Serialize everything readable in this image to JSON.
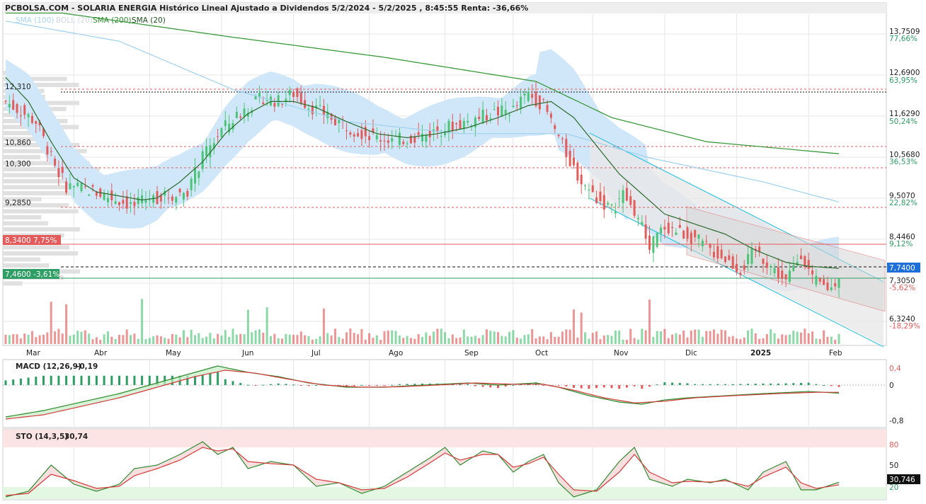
{
  "header": {
    "title": "PCBOLSA.COM - SOLARIA ENERGIA Histórico Lineal Ajustado a Dividendos 5/2/2024 - 5/2/2025 , 8:45:55 Renta: -36,66%"
  },
  "legend": {
    "items": [
      {
        "label": "SMA (100)",
        "color": "#a8d4f0"
      },
      {
        "label": "BOLL (20)",
        "color": "#cfe3f3"
      },
      {
        "label": "SMA (200)",
        "color": "#2e8b2e"
      },
      {
        "label": "SMA (20)",
        "color": "#1f4f1f"
      }
    ]
  },
  "colors": {
    "up": "#4cc477",
    "down": "#e35b5b",
    "boll_fill": "#cfe7f8",
    "sma200": "#3c9a3c",
    "sma100": "#9fd0ee",
    "sma20": "#2d6b2d",
    "channel": "#36c5e0",
    "grid": "#e6e6e6"
  },
  "price_axis": {
    "ticks": [
      {
        "price": "13,7509",
        "pct": "77,66%"
      },
      {
        "price": "12,6900",
        "pct": "63,95%"
      },
      {
        "price": "11,6290",
        "pct": "50,24%"
      },
      {
        "price": "10,5680",
        "pct": "36,53%"
      },
      {
        "price": "9,5070",
        "pct": "22,82%"
      },
      {
        "price": "8,4460",
        "pct": "9,12%"
      },
      {
        "price": "7,3050",
        "pct": "-5,62%"
      },
      {
        "price": "6,3240",
        "pct": "-18,29%"
      }
    ],
    "current_price": "7,7400"
  },
  "level_labels": [
    {
      "label": "12,310"
    },
    {
      "label": "10,860"
    },
    {
      "label": "10,300"
    },
    {
      "label": "9,2850"
    }
  ],
  "price_markers": [
    {
      "label": "8,3400  7,75%",
      "color": "#e35b5b"
    },
    {
      "label": "7,4600  -3,61%",
      "color": "#2e9e64"
    }
  ],
  "x_axis": {
    "labels": [
      "Mar",
      "Abr",
      "May",
      "Jun",
      "Jul",
      "Ago",
      "Sep",
      "Oct",
      "Nov",
      "Dic",
      "2025",
      "Feb"
    ]
  },
  "macd": {
    "title": "MACD (12,26,9)",
    "value": "-0,19",
    "ticks": [
      "0,4",
      "0",
      "-0,8"
    ]
  },
  "sto": {
    "title": "STO (14,3,5)",
    "value": "30,74",
    "ticks": [
      "80",
      "50",
      "20"
    ],
    "current": "30,746"
  },
  "chart_data": {
    "type": "candlestick",
    "title": "SOLARIA ENERGIA Histórico Lineal Ajustado a Dividendos 5/2/2024 - 5/2/2025",
    "price_ylim": [
      5.7,
      14.4
    ],
    "x_months": [
      "Mar",
      "Abr",
      "May",
      "Jun",
      "Jul",
      "Ago",
      "Sep",
      "Oct",
      "Nov",
      "Dic",
      "2025",
      "Feb"
    ],
    "close_anchors": [
      [
        0,
        12.0
      ],
      [
        8,
        11.5
      ],
      [
        12,
        10.6
      ],
      [
        16,
        9.9
      ],
      [
        22,
        9.8
      ],
      [
        28,
        9.6
      ],
      [
        34,
        9.4
      ],
      [
        38,
        9.6
      ],
      [
        44,
        9.65
      ],
      [
        48,
        9.8
      ],
      [
        52,
        10.6
      ],
      [
        57,
        11.3
      ],
      [
        63,
        11.8
      ],
      [
        68,
        12.1
      ],
      [
        72,
        12.0
      ],
      [
        76,
        12.2
      ],
      [
        80,
        11.9
      ],
      [
        86,
        11.6
      ],
      [
        92,
        11.3
      ],
      [
        98,
        11.1
      ],
      [
        104,
        11.05
      ],
      [
        110,
        11.15
      ],
      [
        116,
        11.35
      ],
      [
        122,
        11.5
      ],
      [
        128,
        11.7
      ],
      [
        134,
        11.8
      ],
      [
        138,
        12.2
      ],
      [
        142,
        11.9
      ],
      [
        145,
        11.3
      ],
      [
        148,
        10.7
      ],
      [
        152,
        10.0
      ],
      [
        156,
        9.6
      ],
      [
        160,
        9.3
      ],
      [
        163,
        9.7
      ],
      [
        167,
        9.1
      ],
      [
        170,
        8.4
      ],
      [
        174,
        8.9
      ],
      [
        178,
        8.75
      ],
      [
        182,
        8.6
      ],
      [
        186,
        8.3
      ],
      [
        190,
        8.1
      ],
      [
        194,
        7.8
      ],
      [
        198,
        8.3
      ],
      [
        202,
        7.9
      ],
      [
        206,
        7.5
      ],
      [
        210,
        8.25
      ],
      [
        213,
        7.55
      ],
      [
        216,
        7.4
      ],
      [
        218,
        7.35
      ],
      [
        220,
        7.7
      ]
    ],
    "sma20_anchors": [
      [
        0,
        12.6
      ],
      [
        6,
        12.0
      ],
      [
        12,
        11.0
      ],
      [
        18,
        10.1
      ],
      [
        24,
        9.75
      ],
      [
        30,
        9.65
      ],
      [
        36,
        9.55
      ],
      [
        40,
        9.6
      ],
      [
        46,
        10.0
      ],
      [
        52,
        10.5
      ],
      [
        58,
        11.2
      ],
      [
        64,
        11.7
      ],
      [
        70,
        12.0
      ],
      [
        76,
        12.0
      ],
      [
        82,
        11.85
      ],
      [
        90,
        11.5
      ],
      [
        98,
        11.2
      ],
      [
        106,
        11.1
      ],
      [
        114,
        11.2
      ],
      [
        122,
        11.35
      ],
      [
        130,
        11.6
      ],
      [
        138,
        11.9
      ],
      [
        144,
        12.0
      ],
      [
        150,
        11.6
      ],
      [
        156,
        10.9
      ],
      [
        162,
        10.2
      ],
      [
        168,
        9.7
      ],
      [
        174,
        9.2
      ],
      [
        182,
        8.95
      ],
      [
        190,
        8.7
      ],
      [
        198,
        8.3
      ],
      [
        206,
        8.0
      ],
      [
        212,
        7.9
      ],
      [
        220,
        7.85
      ]
    ],
    "sma100_anchors": [
      [
        0,
        14.0
      ],
      [
        30,
        13.5
      ],
      [
        60,
        12.3
      ],
      [
        90,
        11.5
      ],
      [
        120,
        11.2
      ],
      [
        148,
        11.2
      ],
      [
        170,
        10.6
      ],
      [
        200,
        10.0
      ],
      [
        220,
        9.5
      ]
    ],
    "sma200_anchors": [
      [
        15,
        14.2
      ],
      [
        60,
        13.6
      ],
      [
        100,
        13.1
      ],
      [
        140,
        12.5
      ],
      [
        160,
        11.6
      ],
      [
        185,
        11.0
      ],
      [
        220,
        10.7
      ]
    ],
    "macd_line": [
      [
        0,
        -0.75
      ],
      [
        10,
        -0.6
      ],
      [
        20,
        -0.4
      ],
      [
        30,
        -0.2
      ],
      [
        40,
        0.05
      ],
      [
        50,
        0.3
      ],
      [
        56,
        0.45
      ],
      [
        64,
        0.3
      ],
      [
        72,
        0.2
      ],
      [
        80,
        0.05
      ],
      [
        90,
        -0.05
      ],
      [
        100,
        -0.05
      ],
      [
        110,
        0.0
      ],
      [
        122,
        0.05
      ],
      [
        130,
        0.0
      ],
      [
        140,
        0.05
      ],
      [
        146,
        -0.05
      ],
      [
        154,
        -0.25
      ],
      [
        162,
        -0.4
      ],
      [
        168,
        -0.45
      ],
      [
        174,
        -0.35
      ],
      [
        180,
        -0.3
      ],
      [
        190,
        -0.25
      ],
      [
        200,
        -0.2
      ],
      [
        212,
        -0.15
      ],
      [
        220,
        -0.19
      ]
    ],
    "signal_line": [
      [
        0,
        -0.8
      ],
      [
        10,
        -0.7
      ],
      [
        20,
        -0.5
      ],
      [
        30,
        -0.3
      ],
      [
        40,
        -0.05
      ],
      [
        50,
        0.2
      ],
      [
        58,
        0.35
      ],
      [
        66,
        0.28
      ],
      [
        74,
        0.15
      ],
      [
        84,
        0.0
      ],
      [
        94,
        -0.05
      ],
      [
        104,
        -0.04
      ],
      [
        114,
        0.0
      ],
      [
        124,
        0.05
      ],
      [
        134,
        0.02
      ],
      [
        142,
        0.02
      ],
      [
        150,
        -0.12
      ],
      [
        158,
        -0.3
      ],
      [
        166,
        -0.42
      ],
      [
        174,
        -0.38
      ],
      [
        182,
        -0.3
      ],
      [
        192,
        -0.25
      ],
      [
        204,
        -0.2
      ],
      [
        214,
        -0.17
      ],
      [
        220,
        -0.17
      ]
    ],
    "sto_k": [
      [
        0,
        10
      ],
      [
        6,
        18
      ],
      [
        12,
        55
      ],
      [
        18,
        28
      ],
      [
        24,
        18
      ],
      [
        30,
        28
      ],
      [
        34,
        50
      ],
      [
        40,
        55
      ],
      [
        46,
        70
      ],
      [
        52,
        88
      ],
      [
        56,
        70
      ],
      [
        60,
        80
      ],
      [
        64,
        50
      ],
      [
        70,
        60
      ],
      [
        76,
        55
      ],
      [
        82,
        25
      ],
      [
        88,
        30
      ],
      [
        94,
        15
      ],
      [
        100,
        25
      ],
      [
        106,
        45
      ],
      [
        112,
        65
      ],
      [
        116,
        80
      ],
      [
        120,
        55
      ],
      [
        126,
        75
      ],
      [
        130,
        70
      ],
      [
        134,
        45
      ],
      [
        138,
        60
      ],
      [
        142,
        70
      ],
      [
        146,
        30
      ],
      [
        150,
        10
      ],
      [
        156,
        20
      ],
      [
        162,
        60
      ],
      [
        166,
        80
      ],
      [
        170,
        35
      ],
      [
        176,
        25
      ],
      [
        180,
        35
      ],
      [
        186,
        30
      ],
      [
        190,
        35
      ],
      [
        196,
        20
      ],
      [
        200,
        45
      ],
      [
        206,
        60
      ],
      [
        210,
        20
      ],
      [
        214,
        20
      ],
      [
        220,
        30.74
      ]
    ],
    "sto_d": [
      [
        0,
        12
      ],
      [
        6,
        15
      ],
      [
        12,
        42
      ],
      [
        18,
        33
      ],
      [
        24,
        22
      ],
      [
        30,
        25
      ],
      [
        34,
        40
      ],
      [
        40,
        50
      ],
      [
        46,
        62
      ],
      [
        52,
        80
      ],
      [
        56,
        75
      ],
      [
        60,
        78
      ],
      [
        64,
        60
      ],
      [
        70,
        57
      ],
      [
        76,
        55
      ],
      [
        82,
        35
      ],
      [
        88,
        30
      ],
      [
        94,
        20
      ],
      [
        100,
        22
      ],
      [
        106,
        38
      ],
      [
        112,
        58
      ],
      [
        116,
        72
      ],
      [
        120,
        62
      ],
      [
        126,
        70
      ],
      [
        130,
        70
      ],
      [
        134,
        52
      ],
      [
        138,
        57
      ],
      [
        142,
        66
      ],
      [
        146,
        42
      ],
      [
        150,
        20
      ],
      [
        156,
        18
      ],
      [
        162,
        45
      ],
      [
        166,
        70
      ],
      [
        170,
        45
      ],
      [
        176,
        30
      ],
      [
        180,
        32
      ],
      [
        186,
        31
      ],
      [
        190,
        33
      ],
      [
        196,
        25
      ],
      [
        200,
        38
      ],
      [
        206,
        52
      ],
      [
        210,
        30
      ],
      [
        214,
        22
      ],
      [
        220,
        27
      ]
    ]
  }
}
